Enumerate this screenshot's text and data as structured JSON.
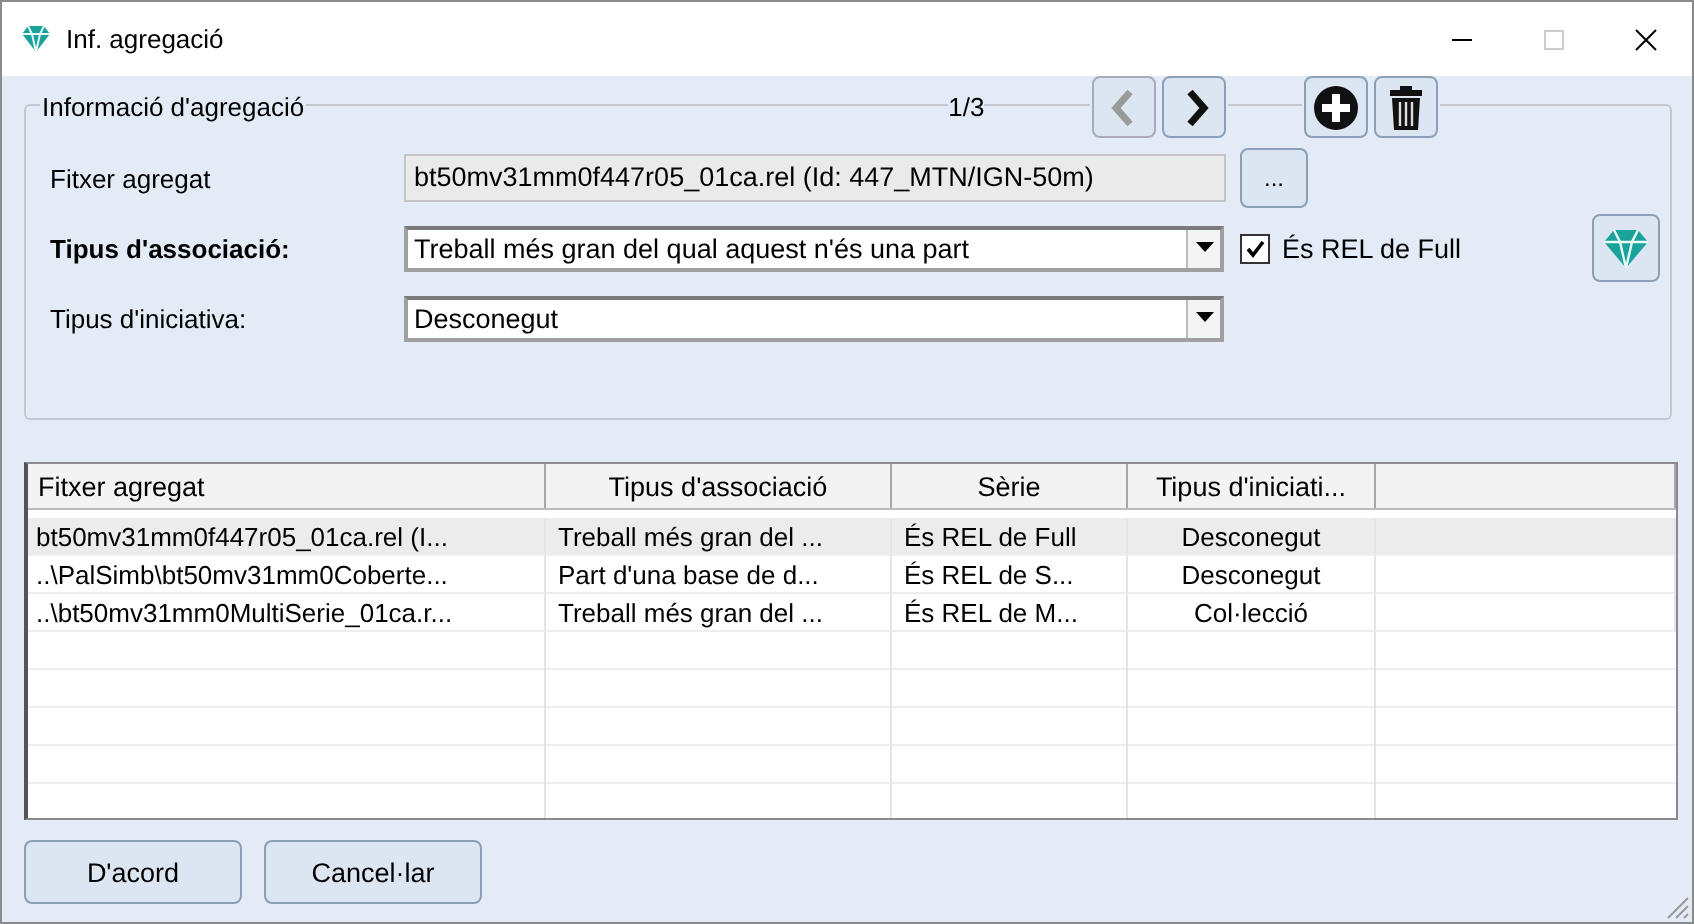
{
  "window": {
    "title": "Inf. agregació"
  },
  "group": {
    "title": "Informació d'agregació",
    "counter": "1/3",
    "nav": [
      {
        "kind": "prev",
        "disabled": true
      },
      {
        "kind": "next",
        "disabled": false
      }
    ],
    "fields": [
      {
        "kind": "text",
        "label": "Fitxer agregat",
        "value": "bt50mv31mm0f447r05_01ca.rel (Id: 447_MTN/IGN-50m)",
        "button": "..."
      },
      {
        "kind": "combo",
        "label": "Tipus d'associació:",
        "value": "Treball més gran del qual aquest n'és una part",
        "checkbox": {
          "label": "És REL de Full",
          "checked": true
        }
      },
      {
        "kind": "combo",
        "label": "Tipus d'iniciativa:",
        "value": "Desconegut"
      }
    ]
  },
  "table": {
    "columns": [
      "Fitxer agregat",
      "Tipus d'associació",
      "Sèrie",
      "Tipus d'iniciati..."
    ],
    "rows": [
      {
        "selected": true,
        "cells": [
          "bt50mv31mm0f447r05_01ca.rel (I...",
          "Treball més gran del ...",
          "És REL de Full",
          "Desconegut"
        ]
      },
      {
        "selected": false,
        "cells": [
          "..\\PalSimb\\bt50mv31mm0Coberte...",
          "Part d'una base de d...",
          "És REL de S...",
          "Desconegut"
        ]
      },
      {
        "selected": false,
        "cells": [
          "..\\bt50mv31mm0MultiSerie_01ca.r...",
          "Treball més gran del ...",
          "És REL de M...",
          "Col·lecció"
        ]
      }
    ]
  },
  "buttons": [
    "D'acord",
    "Cancel·lar"
  ]
}
